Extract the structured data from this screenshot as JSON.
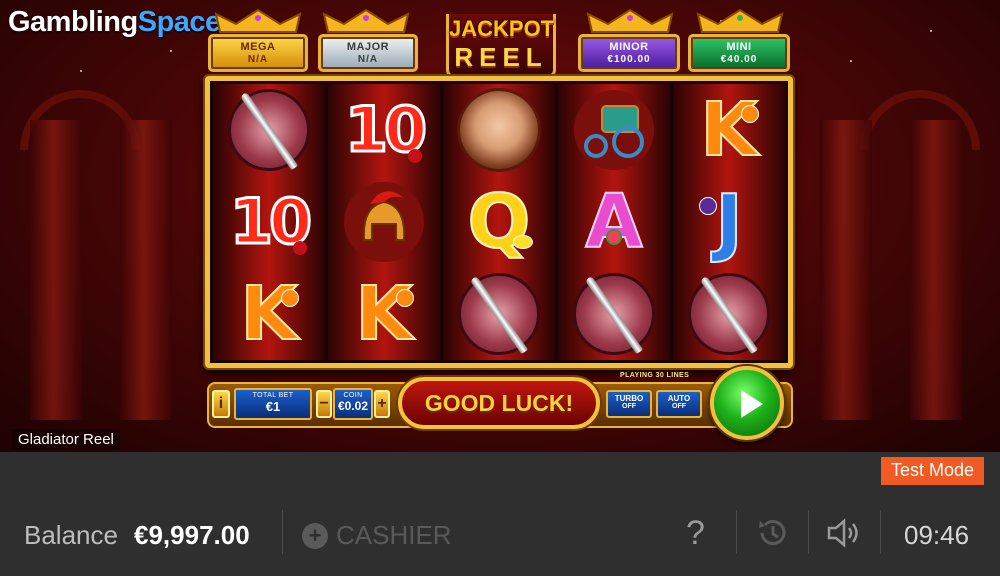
{
  "brand": {
    "part1": "Gambling",
    "part2": "Space"
  },
  "jackpots": [
    {
      "name": "MEGA",
      "value": "N/A",
      "color": "#f5c23a"
    },
    {
      "name": "MAJOR",
      "value": "N/A",
      "color": "#c9d3dc"
    },
    {
      "name": "MINOR",
      "value": "€100.00",
      "color": "#7b3fd0"
    },
    {
      "name": "MINI",
      "value": "€40.00",
      "color": "#1aa54a"
    }
  ],
  "jackpot_reel_title": {
    "line1": "JACKPOT",
    "line2": "REEL"
  },
  "reels": [
    [
      "shield-sword",
      "ten-cherry",
      "king-orange"
    ],
    [
      "ten-cherry",
      "gladiator-helmet",
      "king-orange"
    ],
    [
      "portrait-woman",
      "queen-lemon",
      "shield-sword"
    ],
    [
      "chariot",
      "ace-watermelon",
      "shield-sword"
    ],
    [
      "king-orange",
      "jack-plum",
      "shield-sword"
    ]
  ],
  "controls": {
    "info_label": "i",
    "total_bet_label": "TOTAL BET",
    "total_bet_value": "€1",
    "coin_label": "COIN",
    "coin_value": "€0.02",
    "minus_label": "−",
    "plus_label": "+",
    "good_luck": "GOOD LUCK!",
    "playing_lines": "PLAYING 30 LINES",
    "turbo_label": "TURBO",
    "turbo_state": "OFF",
    "auto_label": "AUTO",
    "auto_state": "OFF"
  },
  "game_name": "Gladiator Reel",
  "bottom_bar": {
    "test_mode": "Test Mode",
    "balance_label": "Balance",
    "balance_value": "€9,997.00",
    "cashier_label": "CASHIER",
    "help_label": "?",
    "clock": "09:46"
  },
  "icons": {
    "history": "history-clock-icon",
    "sound": "speaker-icon",
    "spin": "play-triangle-icon",
    "cashier": "plus-circle-icon"
  }
}
